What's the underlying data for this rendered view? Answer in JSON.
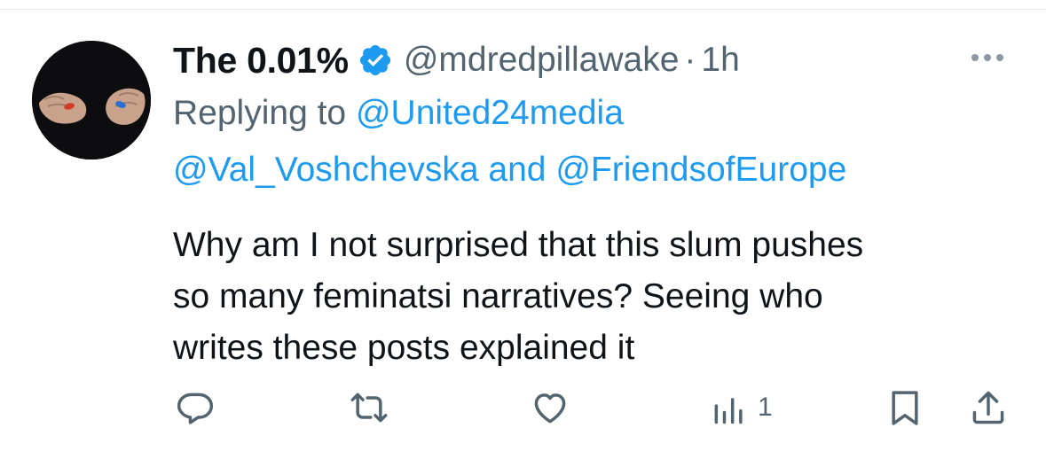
{
  "tweet": {
    "display_name": "The 0.01%",
    "handle": "@mdredpillawake",
    "separator": "·",
    "time": "1h",
    "replying_prefix": "Replying to",
    "reply_to_1": "@United24media",
    "reply_to_2": "@Val_Voshchevska",
    "reply_conjunction": "and",
    "reply_to_3": "@FriendsofEurope",
    "body_line_1": "Why am I not surprised that this slum pushes",
    "body_line_2": "so many feminatsi narratives? Seeing who",
    "body_line_3": "writes these posts explained it"
  },
  "actions": {
    "views_count": "1"
  },
  "icons": {
    "verified": "verified-badge-icon",
    "more": "more-options-icon",
    "reply": "reply-icon",
    "retweet": "retweet-icon",
    "like": "like-icon",
    "views": "views-icon",
    "bookmark": "bookmark-icon",
    "share": "share-icon"
  },
  "colors": {
    "accent": "#1d9bf0",
    "text": "#0f1419",
    "secondary": "#536471"
  }
}
